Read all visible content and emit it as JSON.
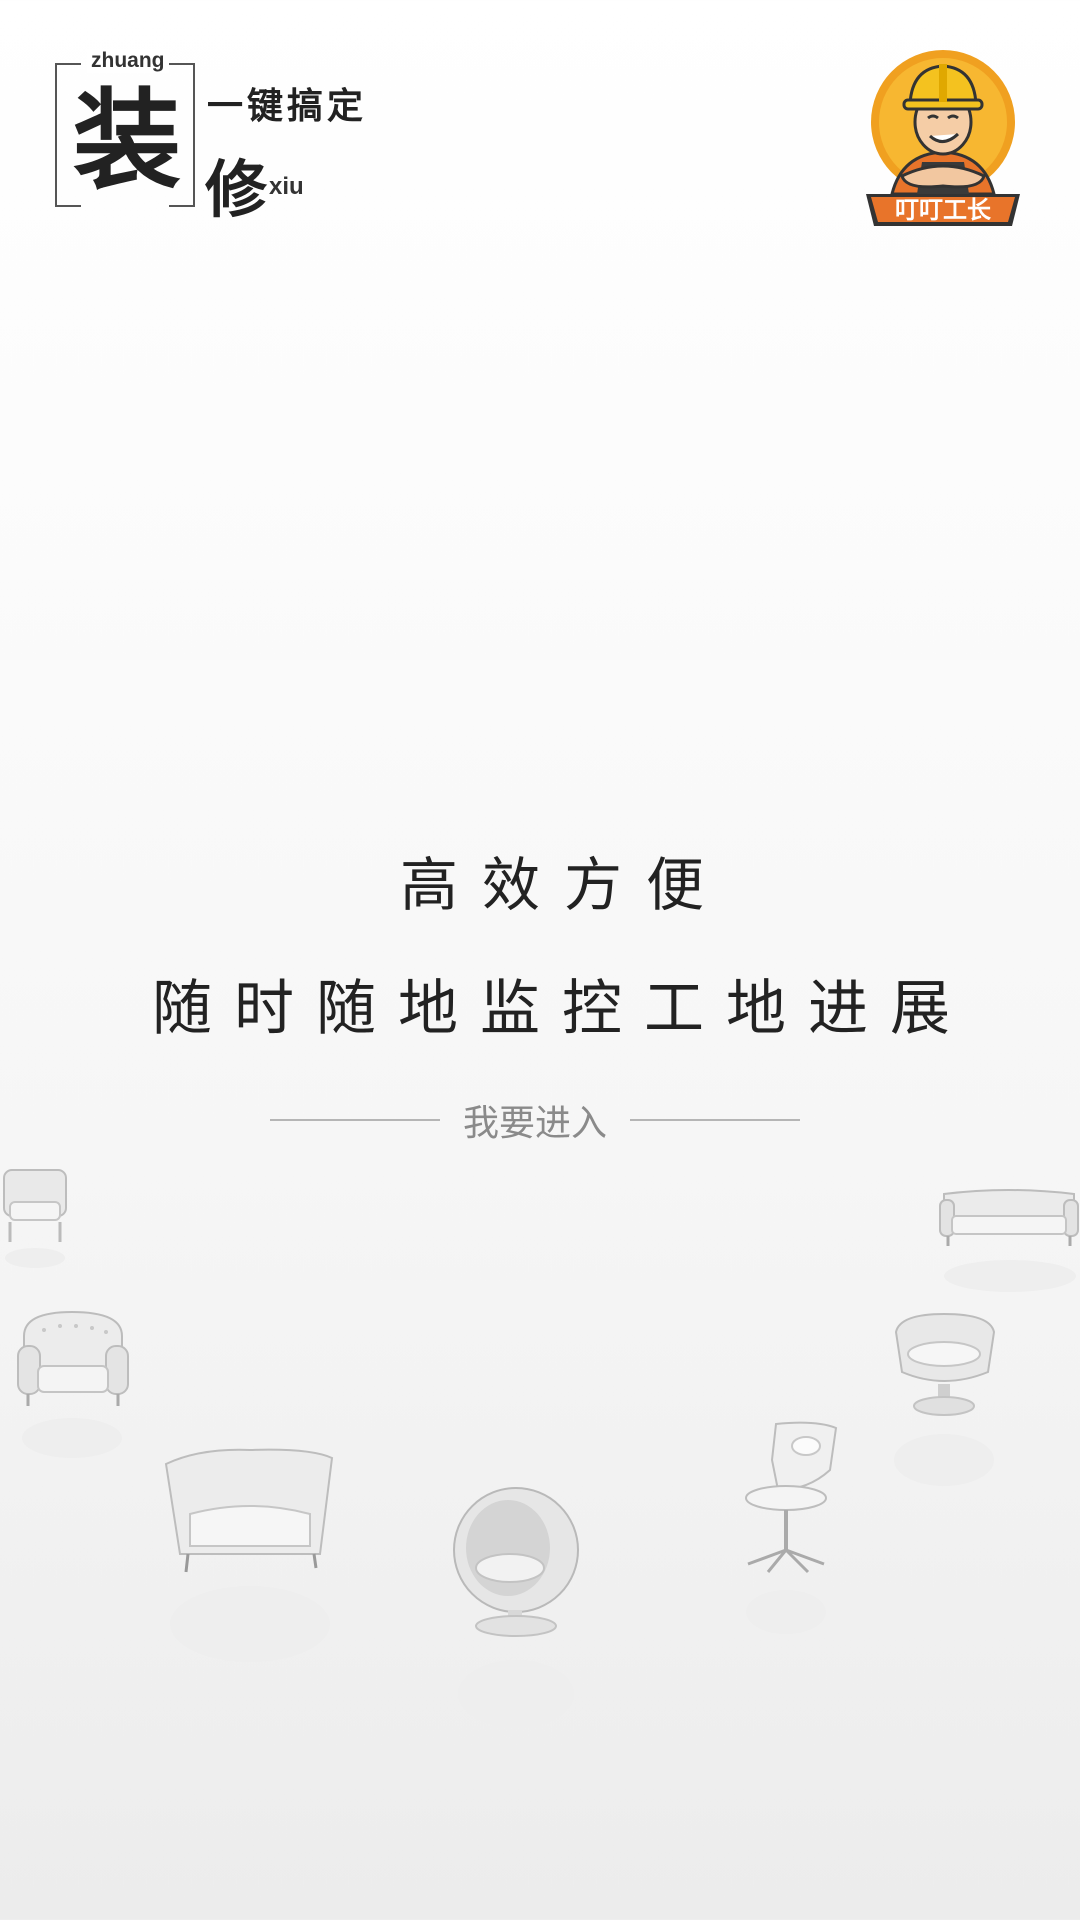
{
  "brand": {
    "pinyin_top": "zhuang",
    "char_zhuang": "装",
    "slogan": "一键搞定",
    "char_xiu": "修",
    "pinyin_bottom": "xiu"
  },
  "mascot": {
    "badge_text": "叮叮工长"
  },
  "headline": {
    "line1": "高效方便",
    "line2": "随时随地监控工地进展"
  },
  "enter_button": {
    "label": "我要进入"
  },
  "colors": {
    "text": "#222222",
    "divider": "#b5b5b5",
    "button_text": "#8a8a8a",
    "mascot_orange": "#f0a020"
  }
}
